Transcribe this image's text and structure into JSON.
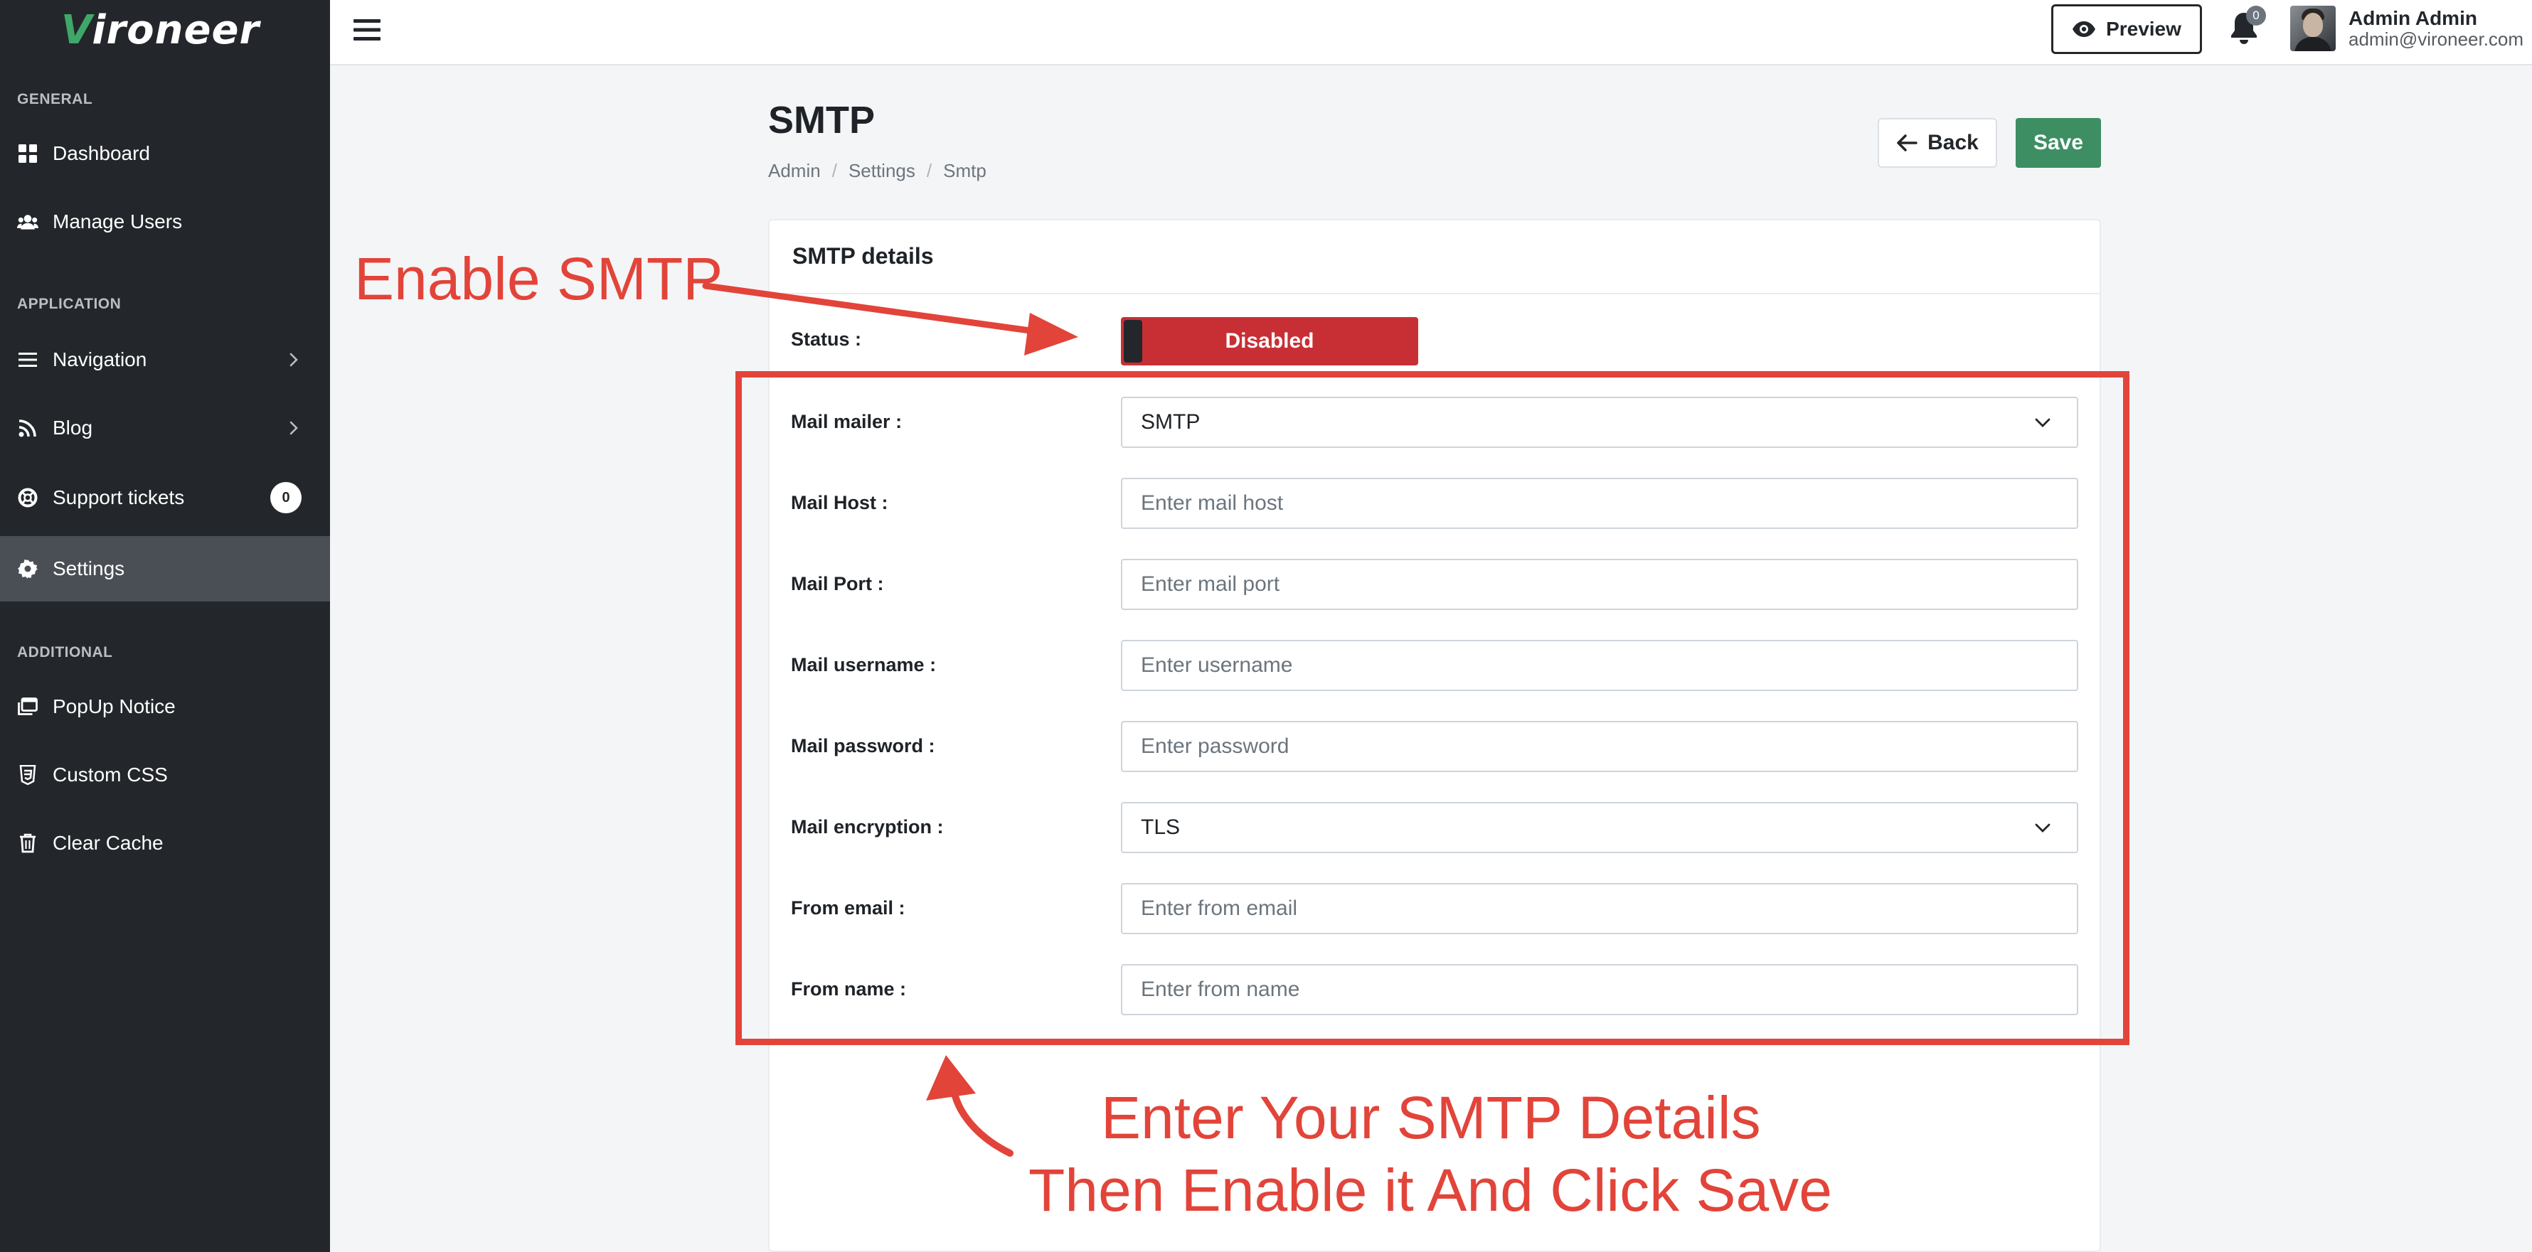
{
  "brand": {
    "logo_v": "V",
    "logo_rest": "ironeer"
  },
  "sidebar": {
    "sections": [
      {
        "heading": "GENERAL"
      },
      {
        "heading": "APPLICATION"
      },
      {
        "heading": "ADDITIONAL"
      }
    ],
    "items": [
      {
        "label": "Dashboard",
        "icon": "dashboard-icon"
      },
      {
        "label": "Manage Users",
        "icon": "users-icon"
      },
      {
        "label": "Navigation",
        "icon": "list-icon"
      },
      {
        "label": "Blog",
        "icon": "rss-icon"
      },
      {
        "label": "Support tickets",
        "icon": "lifebuoy-icon",
        "count": "0"
      },
      {
        "label": "Settings",
        "icon": "gear-icon",
        "active": true
      },
      {
        "label": "PopUp Notice",
        "icon": "window-icon"
      },
      {
        "label": "Custom CSS",
        "icon": "css-icon"
      },
      {
        "label": "Clear Cache",
        "icon": "trash-icon"
      }
    ]
  },
  "topbar": {
    "preview_label": "Preview",
    "notification_count": "0",
    "user_name": "Admin Admin",
    "user_email": "admin@vironeer.com"
  },
  "page": {
    "title": "SMTP",
    "breadcrumb": [
      "Admin",
      "Settings",
      "Smtp"
    ],
    "back_label": "Back",
    "save_label": "Save"
  },
  "card": {
    "title": "SMTP details",
    "status_label": "Status :",
    "status_value": "Disabled",
    "fields": [
      {
        "label": "Mail mailer :",
        "value": "SMTP",
        "type": "select"
      },
      {
        "label": "Mail Host :",
        "placeholder": "Enter mail host",
        "type": "text"
      },
      {
        "label": "Mail Port :",
        "placeholder": "Enter mail port",
        "type": "text"
      },
      {
        "label": "Mail username :",
        "placeholder": "Enter username",
        "type": "text"
      },
      {
        "label": "Mail password :",
        "placeholder": "Enter password",
        "type": "password"
      },
      {
        "label": "Mail encryption :",
        "value": "TLS",
        "type": "select"
      },
      {
        "label": "From email :",
        "placeholder": "Enter from email",
        "type": "text"
      },
      {
        "label": "From name :",
        "placeholder": "Enter from name",
        "type": "text"
      }
    ]
  },
  "annotations": {
    "enable_smtp": "Enable SMTP",
    "instruction_line1": "Enter Your SMTP Details",
    "instruction_line2": "Then Enable it And Click Save",
    "color": "#e2443a"
  },
  "colors": {
    "sidebar_bg": "#23272b",
    "sidebar_active": "#4a4f55",
    "save_green": "#3e8e63",
    "status_red": "#c82f35"
  }
}
